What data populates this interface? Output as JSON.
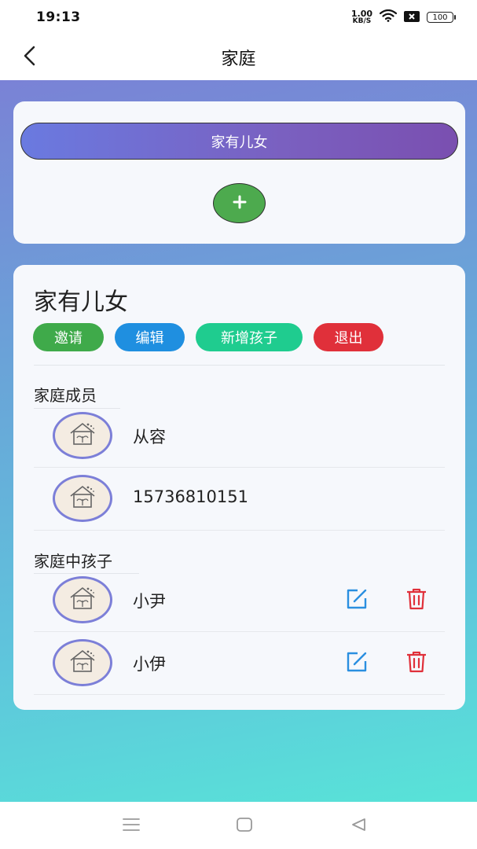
{
  "status_bar": {
    "time": "19:13",
    "net_speed_value": "1.00",
    "net_speed_unit": "KB/S",
    "battery": "100"
  },
  "header": {
    "title": "家庭",
    "back_icon": "chevron-left-icon"
  },
  "family_selector": {
    "selected_family": "家有儿女",
    "add_icon": "plus-icon"
  },
  "family_detail": {
    "name": "家有儿女",
    "actions": {
      "invite": "邀请",
      "edit": "编辑",
      "add_child": "新增孩子",
      "exit": "退出"
    },
    "members_title": "家庭成员",
    "members": [
      {
        "name": "从容"
      },
      {
        "name": "15736810151"
      }
    ],
    "children_title": "家庭中孩子",
    "children": [
      {
        "name": "小尹"
      },
      {
        "name": "小伊"
      }
    ]
  },
  "colors": {
    "invite": "#3faa4a",
    "edit": "#1f8fe0",
    "add_child": "#1fcc8f",
    "exit": "#e0303a",
    "add_button": "#4daa4e",
    "edit_icon": "#2a8fe0",
    "delete_icon": "#e0303a"
  },
  "nav_bar": {
    "icons": [
      "menu-icon",
      "home-square-icon",
      "back-triangle-icon"
    ]
  }
}
